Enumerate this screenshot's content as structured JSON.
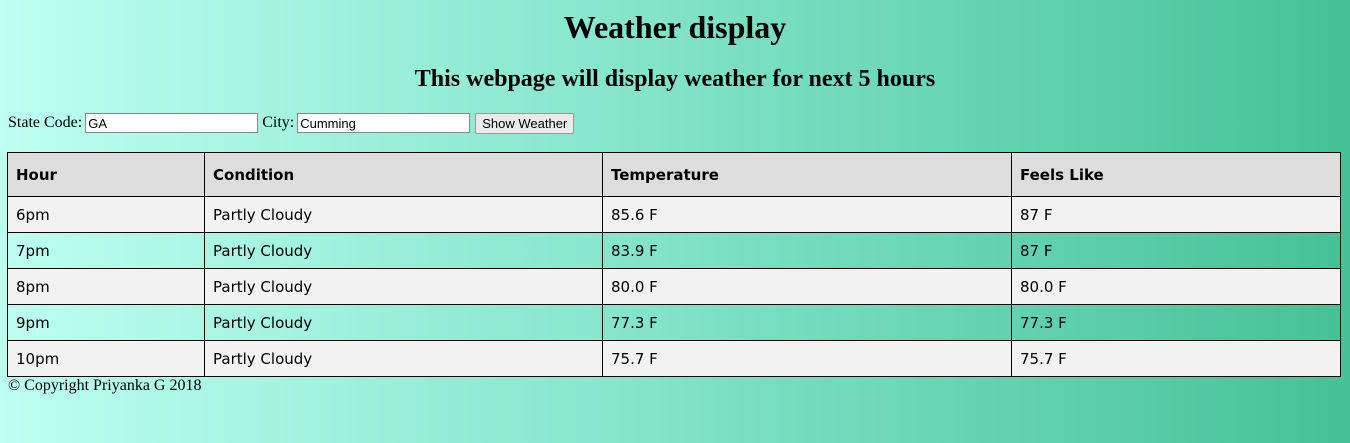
{
  "header": {
    "title": "Weather display",
    "subtitle": "This webpage will display weather for next 5 hours"
  },
  "form": {
    "state_label": "State Code:",
    "state_value": "GA",
    "city_label": "City:",
    "city_value": "Cumming",
    "button_label": "Show Weather"
  },
  "table": {
    "headers": [
      "Hour",
      "Condition",
      "Temperature",
      "Feels Like"
    ],
    "rows": [
      [
        "6pm",
        "Partly Cloudy",
        "85.6 F",
        "87 F"
      ],
      [
        "7pm",
        "Partly Cloudy",
        "83.9 F",
        "87 F"
      ],
      [
        "8pm",
        "Partly Cloudy",
        "80.0 F",
        "80.0 F"
      ],
      [
        "9pm",
        "Partly Cloudy",
        "77.3 F",
        "77.3 F"
      ],
      [
        "10pm",
        "Partly Cloudy",
        "75.7 F",
        "75.7 F"
      ]
    ]
  },
  "footer": {
    "copyright": "© Copyright Priyanka G 2018"
  },
  "colors": {
    "gradient_left": "#bdfff0",
    "gradient_right": "#45c197",
    "header_row": "#dddddd",
    "odd_row": "#f2f2f2"
  }
}
